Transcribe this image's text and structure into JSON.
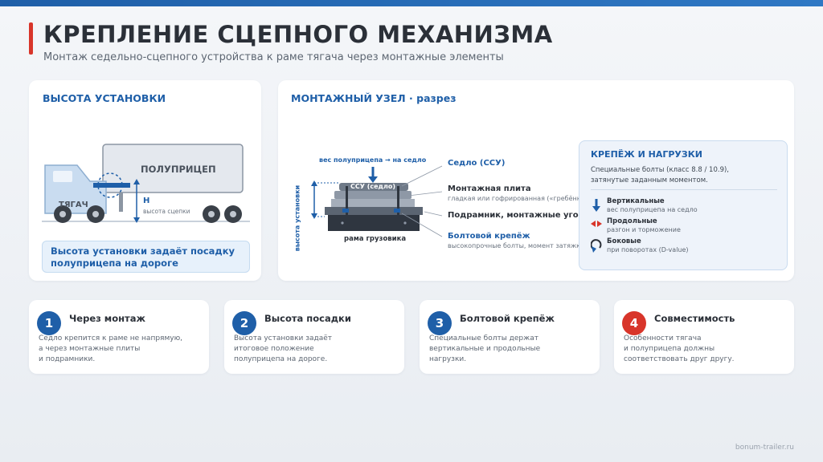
{
  "header": {
    "title": "КРЕПЛЕНИЕ СЦЕПНОГО МЕХАНИЗМА",
    "subtitle": "Монтаж седельно-сцепного устройства к раме тягача через монтажные элементы"
  },
  "height_card": {
    "title": "ВЫСОТА УСТАНОВКИ",
    "semitrailer_label": "ПОЛУПРИЦЕП",
    "tractor_label": "ТЯГАЧ",
    "h_label": "H",
    "h_sub": "высота сцепки",
    "note": "Высота установки задаёт посадку полуприцепа на дороге"
  },
  "node_card": {
    "title": "МОНТАЖНЫЙ УЗЕЛ · разрез",
    "weight_label": "вес полуприцепа → на седло",
    "vertical_axis_label": "высота установки",
    "ssu_inline": "ССУ (седло)",
    "frame_label": "рама грузовика",
    "callouts": [
      {
        "main": "Седло (ССУ)",
        "sub": ""
      },
      {
        "main": "Монтажная плита",
        "sub": "гладкая или гофрированная («гребёнка»)"
      },
      {
        "main": "Подрамник, монтажные уголки",
        "sub": ""
      },
      {
        "main": "Болтовой крепёж",
        "sub": "высокопрочные болты, момент затяжки"
      }
    ],
    "loads": {
      "title": "КРЕПЁЖ И НАГРУЗКИ",
      "desc_line1": "Специальные болты (класс 8.8 / 10.9),",
      "desc_line2": "затянутые заданным моментом.",
      "items": [
        {
          "icon": "arrow-down-icon",
          "main": "Вертикальные",
          "sub": "вес полуприцепа на седло"
        },
        {
          "icon": "double-arrow-icon",
          "main": "Продольные",
          "sub": "разгон и торможение"
        },
        {
          "icon": "curved-arrow-icon",
          "main": "Боковые",
          "sub": "при поворотах (D-value)"
        }
      ]
    }
  },
  "steps": [
    {
      "num": "1",
      "title": "Через монтаж",
      "lines": [
        "Седло крепится к раме не напрямую,",
        "а через монтажные плиты",
        "и подрамники."
      ]
    },
    {
      "num": "2",
      "title": "Высота посадки",
      "lines": [
        "Высота установки задаёт",
        "итоговое положение",
        "полуприцепа на дороге."
      ]
    },
    {
      "num": "3",
      "title": "Болтовой крепёж",
      "lines": [
        "Специальные болты держат",
        "вертикальные и продольные",
        "нагрузки."
      ]
    },
    {
      "num": "4",
      "title": "Совместимость",
      "lines": [
        "Особенности тягача",
        "и полуприцепа должны",
        "соответствовать друг другу."
      ]
    }
  ],
  "footer": "bonum-trailer.ru",
  "colors": {
    "accent": "#1f5fa8",
    "alert": "#d8352a"
  }
}
